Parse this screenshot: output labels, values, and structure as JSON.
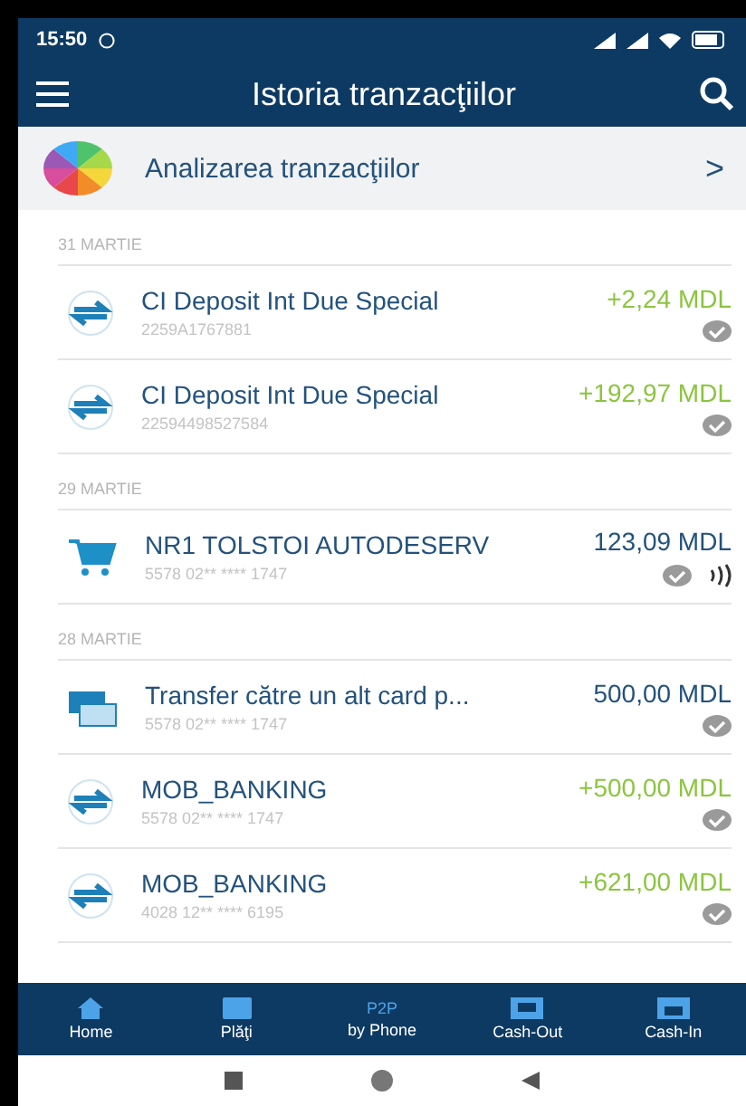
{
  "status_bar": {
    "time": "15:50"
  },
  "header": {
    "title": "Istoria tranzacţiilor"
  },
  "analysis": {
    "label": "Analizarea tranzacţiilor",
    "chevron": ">"
  },
  "groups": [
    {
      "date": "31 MARTIE",
      "transactions": [
        {
          "kind": "transfer",
          "title": "CI Deposit Int Due Special",
          "subtitle": "2259A1767881",
          "amount": "+2,24 MDL",
          "color": "#8bc53f",
          "confirmed": true,
          "contactless": false
        },
        {
          "kind": "transfer",
          "title": "CI Deposit Int Due Special",
          "subtitle": "22594498527584",
          "amount": "+192,97 MDL",
          "color": "#8bc53f",
          "confirmed": true,
          "contactless": false
        }
      ]
    },
    {
      "date": "29 MARTIE",
      "transactions": [
        {
          "kind": "purchase",
          "title": "NR1 TOLSTOI AUTODESERV",
          "subtitle": "5578 02** **** 1747",
          "amount": "123,09 MDL",
          "color": "#23527c",
          "confirmed": true,
          "contactless": true
        }
      ]
    },
    {
      "date": "28 MARTIE",
      "transactions": [
        {
          "kind": "card",
          "title": "Transfer către un alt card p...",
          "subtitle": "5578 02** **** 1747",
          "amount": "500,00 MDL",
          "color": "#23527c",
          "confirmed": true,
          "contactless": false
        },
        {
          "kind": "transfer",
          "title": "MOB_BANKING",
          "subtitle": "5578 02** **** 1747",
          "amount": "+500,00 MDL",
          "color": "#8bc53f",
          "confirmed": true,
          "contactless": false
        },
        {
          "kind": "transfer",
          "title": "MOB_BANKING",
          "subtitle": "4028 12** **** 6195",
          "amount": "+621,00 MDL",
          "color": "#8bc53f",
          "confirmed": true,
          "contactless": false
        }
      ]
    }
  ],
  "bottom_nav": [
    {
      "kind": "home",
      "label": "Home"
    },
    {
      "kind": "payments",
      "label": "Plăţi"
    },
    {
      "kind": "text",
      "icon_text": "P2P",
      "label": "by Phone"
    },
    {
      "kind": "cashout",
      "label": "Cash-Out"
    },
    {
      "kind": "cashin",
      "label": "Cash-In"
    }
  ]
}
